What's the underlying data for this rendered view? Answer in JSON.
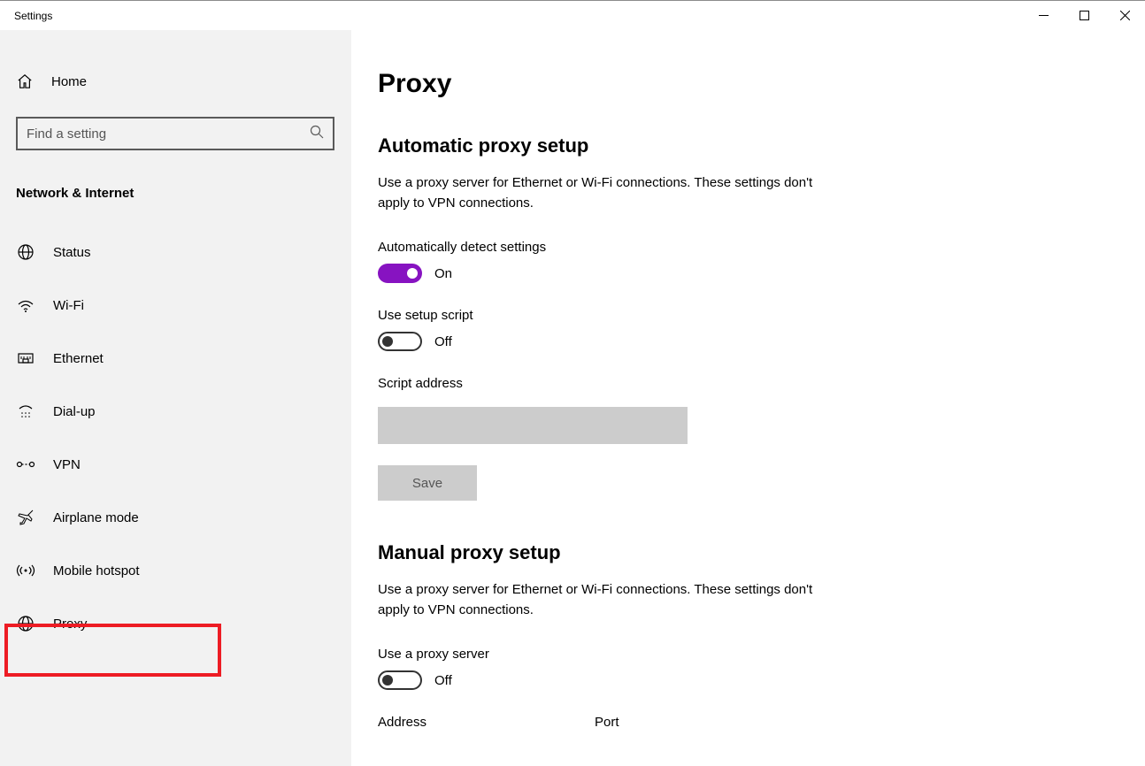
{
  "window": {
    "title": "Settings"
  },
  "sidebar": {
    "home": "Home",
    "search_placeholder": "Find a setting",
    "section": "Network & Internet",
    "items": [
      {
        "label": "Status"
      },
      {
        "label": "Wi-Fi"
      },
      {
        "label": "Ethernet"
      },
      {
        "label": "Dial-up"
      },
      {
        "label": "VPN"
      },
      {
        "label": "Airplane mode"
      },
      {
        "label": "Mobile hotspot"
      },
      {
        "label": "Proxy",
        "selected": true,
        "highlighted": true
      }
    ]
  },
  "page": {
    "title": "Proxy",
    "auto": {
      "heading": "Automatic proxy setup",
      "desc": "Use a proxy server for Ethernet or Wi-Fi connections. These settings don't apply to VPN connections.",
      "auto_detect_label": "Automatically detect settings",
      "auto_detect_state": "On",
      "use_script_label": "Use setup script",
      "use_script_state": "Off",
      "script_address_label": "Script address",
      "script_address_value": "",
      "save_label": "Save"
    },
    "manual": {
      "heading": "Manual proxy setup",
      "desc": "Use a proxy server for Ethernet or Wi-Fi connections. These settings don't apply to VPN connections.",
      "use_proxy_label": "Use a proxy server",
      "use_proxy_state": "Off",
      "address_label": "Address",
      "port_label": "Port"
    }
  }
}
